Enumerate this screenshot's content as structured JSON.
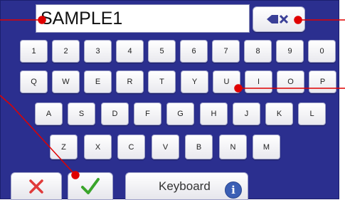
{
  "text_field": {
    "value": "SAMPLE1"
  },
  "rows": [
    [
      "1",
      "2",
      "3",
      "4",
      "5",
      "6",
      "7",
      "8",
      "9",
      "0"
    ],
    [
      "Q",
      "W",
      "E",
      "R",
      "T",
      "Y",
      "U",
      "I",
      "O",
      "P"
    ],
    [
      "A",
      "S",
      "D",
      "F",
      "G",
      "H",
      "J",
      "K",
      "L"
    ],
    [
      "Z",
      "X",
      "C",
      "V",
      "B",
      "N",
      "M"
    ]
  ],
  "bottom_bar": {
    "info_label": "Keyboard",
    "info_icon_glyph": "i"
  },
  "icons": {
    "backspace": "backspace-icon",
    "cancel": "cross-icon",
    "confirm": "checkmark-icon",
    "info": "info-icon"
  },
  "colors": {
    "panel_background": "#2b2f8f",
    "callout": "#e00000",
    "cancel_icon": "#e03a3a",
    "confirm_icon": "#3aa52b",
    "backspace_icon": "#3a3f97",
    "info_icon": "#3b5fb5"
  }
}
